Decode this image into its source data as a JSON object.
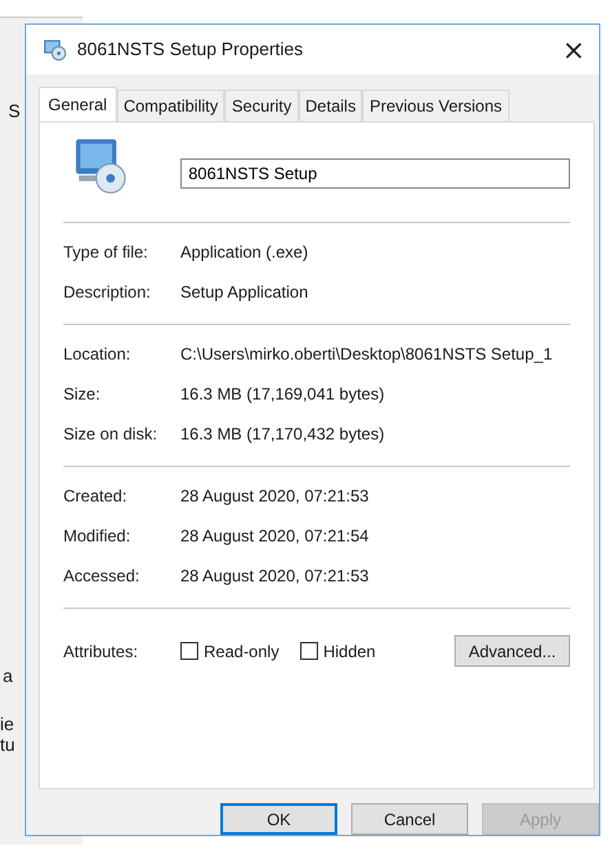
{
  "background_window": {
    "texts": [
      "S",
      "a",
      "ie",
      "tu"
    ]
  },
  "window": {
    "title": "8061NSTS Setup Properties",
    "close": "×"
  },
  "tabs": [
    {
      "label": "General",
      "selected": true
    },
    {
      "label": "Compatibility",
      "selected": false
    },
    {
      "label": "Security",
      "selected": false
    },
    {
      "label": "Details",
      "selected": false
    },
    {
      "label": "Previous Versions",
      "selected": false
    }
  ],
  "file_name": {
    "value": "8061NSTS Setup"
  },
  "sections": [
    [
      {
        "label": "Type of file:",
        "value": "Application (.exe)"
      },
      {
        "label": "Description:",
        "value": "Setup Application"
      }
    ],
    [
      {
        "label": "Location:",
        "value": "C:\\Users\\mirko.oberti\\Desktop\\8061NSTS Setup_1"
      },
      {
        "label": "Size:",
        "value": "16.3 MB (17,169,041 bytes)"
      },
      {
        "label": "Size on disk:",
        "value": "16.3 MB (17,170,432 bytes)"
      }
    ],
    [
      {
        "label": "Created:",
        "value": "28 August 2020, 07:21:53"
      },
      {
        "label": "Modified:",
        "value": "28 August 2020, 07:21:54"
      },
      {
        "label": "Accessed:",
        "value": "28 August 2020, 07:21:53"
      }
    ]
  ],
  "attributes": {
    "label": "Attributes:",
    "options": [
      {
        "label": "Read-only",
        "checked": false
      },
      {
        "label": "Hidden",
        "checked": false
      }
    ],
    "button": "Advanced..."
  },
  "buttons": [
    {
      "label": "OK",
      "default": true,
      "disabled": false
    },
    {
      "label": "Cancel",
      "default": false,
      "disabled": false
    },
    {
      "label": "Apply",
      "default": false,
      "disabled": true
    }
  ]
}
